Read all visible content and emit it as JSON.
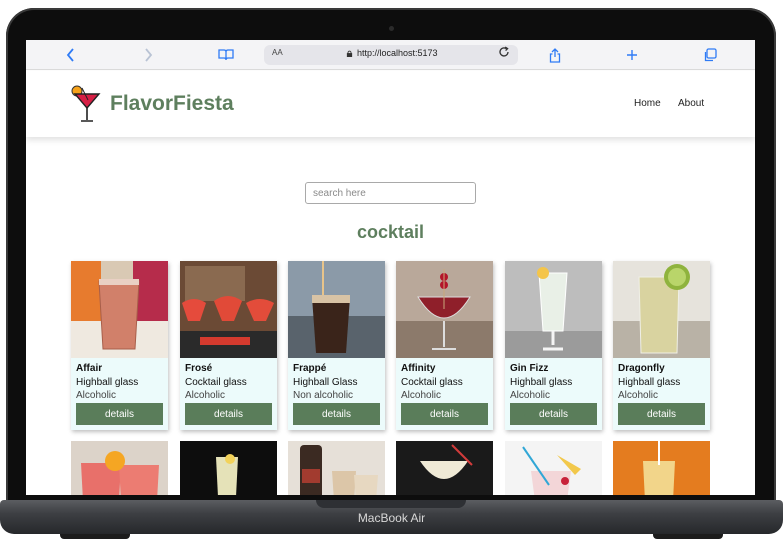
{
  "device": {
    "model": "MacBook Air"
  },
  "browser": {
    "text_size_label": "AA",
    "url": "http://localhost:5173"
  },
  "app": {
    "brand": "FlavorFiesta",
    "nav": [
      {
        "label": "Home"
      },
      {
        "label": "About"
      }
    ],
    "search": {
      "placeholder": "search here",
      "value": ""
    },
    "heading": "cocktail"
  },
  "cards": [
    {
      "name": "Affair",
      "glass": "Highball glass",
      "type": "Alcoholic",
      "button": "details"
    },
    {
      "name": "Frosé",
      "glass": "Cocktail glass",
      "type": "Alcoholic",
      "button": "details"
    },
    {
      "name": "Frappé",
      "glass": "Highball Glass",
      "type": "Non alcoholic",
      "button": "details"
    },
    {
      "name": "Affinity",
      "glass": "Cocktail glass",
      "type": "Alcoholic",
      "button": "details"
    },
    {
      "name": "Gin Fizz",
      "glass": "Highball glass",
      "type": "Alcoholic",
      "button": "details"
    },
    {
      "name": "Dragonfly",
      "glass": "Highball glass",
      "type": "Alcoholic",
      "button": "details"
    }
  ],
  "colors": {
    "brand_green": "#5e7f5e",
    "button_green": "#5a7d5a",
    "card_bg": "#ecfbfb",
    "browser_accent": "#2f7bf5"
  },
  "icons": [
    "back-icon",
    "forward-icon",
    "reader-book-icon",
    "lock-icon",
    "reload-icon",
    "share-icon",
    "new-tab-plus-icon",
    "tabs-overview-icon",
    "cocktail-logo-icon"
  ]
}
